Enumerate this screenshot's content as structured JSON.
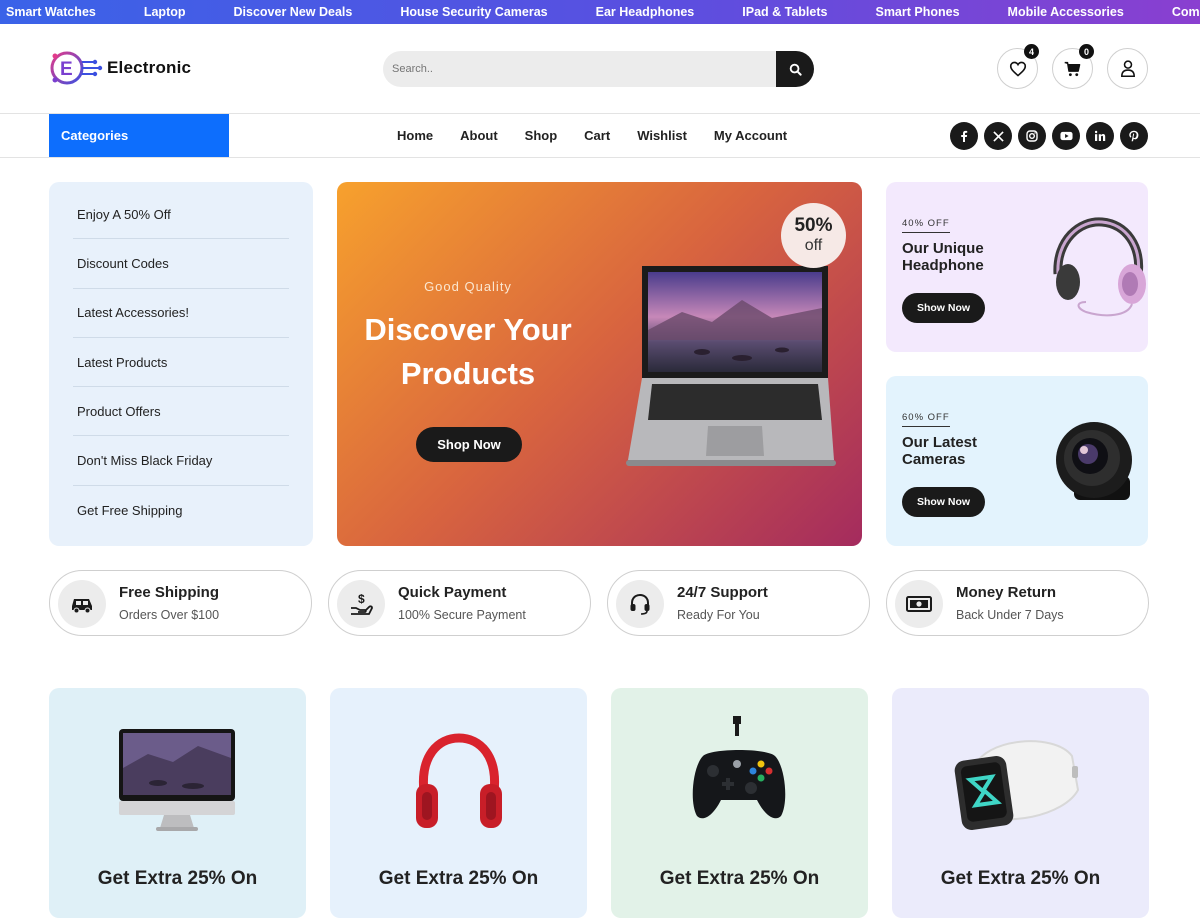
{
  "ticker": [
    "Smart Watches",
    "Laptop",
    "Discover New Deals",
    "House Security Cameras",
    "Ear Headphones",
    "IPad & Tablets",
    "Smart Phones",
    "Mobile Accessories",
    "Computer"
  ],
  "header": {
    "logo_text": "Electronic",
    "search_placeholder": "Search..",
    "wishlist_count": "4",
    "cart_count": "0"
  },
  "nav": {
    "categories_label": "Categories",
    "menu": [
      "Home",
      "About",
      "Shop",
      "Cart",
      "Wishlist",
      "My Account"
    ],
    "socials": [
      "facebook-icon",
      "x-icon",
      "instagram-icon",
      "youtube-icon",
      "linkedin-icon",
      "pinterest-icon"
    ]
  },
  "sidebar": {
    "items": [
      "Enjoy A 50% Off",
      "Discount Codes",
      "Latest Accessories!",
      "Latest Products",
      "Product Offers",
      "Don't Miss Black Friday",
      "Get Free Shipping"
    ]
  },
  "hero": {
    "kicker": "Good Quality",
    "title_line1": "Discover Your",
    "title_line2": "Products",
    "button": "Shop Now",
    "badge_big": "50%",
    "badge_small": "off"
  },
  "promos": [
    {
      "off": "40% OFF",
      "title": "Our Unique Headphone",
      "button": "Show Now",
      "bg": "#f3e9fd"
    },
    {
      "off": "60% OFF",
      "title": "Our Latest Cameras",
      "button": "Show Now",
      "bg": "#e3f3fd"
    }
  ],
  "features": [
    {
      "title": "Free Shipping",
      "subtitle": "Orders Over $100",
      "icon": "car-icon"
    },
    {
      "title": "Quick Payment",
      "subtitle": "100% Secure Payment",
      "icon": "money-hand-icon"
    },
    {
      "title": "24/7 Support",
      "subtitle": "Ready For You",
      "icon": "headset-icon"
    },
    {
      "title": "Money Return",
      "subtitle": "Back Under 7 Days",
      "icon": "cash-icon"
    }
  ],
  "products": [
    {
      "title": "Get Extra 25% On",
      "icon": "imac-icon",
      "bg": "#dff0f7"
    },
    {
      "title": "Get Extra 25% On",
      "icon": "headphones-icon",
      "bg": "#e6f1fc"
    },
    {
      "title": "Get Extra 25% On",
      "icon": "gamepad-icon",
      "bg": "#e2f2e8"
    },
    {
      "title": "Get Extra 25% On",
      "icon": "smartwatch-icon",
      "bg": "#ebebfb"
    }
  ],
  "colors": {
    "accent": "#0d6efd",
    "dark": "#1a1a1a",
    "ticker_start": "#3a63e8",
    "ticker_end": "#8a3fd0"
  }
}
